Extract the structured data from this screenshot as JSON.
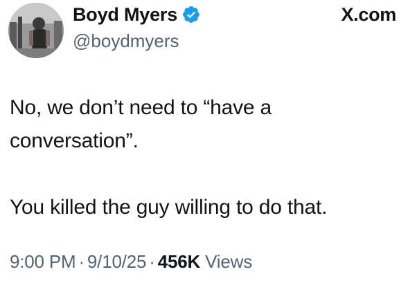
{
  "author": {
    "display_name": "Boyd Myers",
    "handle": "@boydmyers",
    "verified": true
  },
  "source": "X.com",
  "tweet": {
    "lines": [
      "No, we don’t need to “have a",
      "conversation”.",
      "You killed the guy willing to do that."
    ],
    "time": "9:00 PM",
    "date": "9/10/25",
    "separator": "·",
    "views_count": "456K",
    "views_label": "Views"
  },
  "colors": {
    "text": "#0f1419",
    "secondary": "#536471",
    "verified_badge": "#1d9bf0"
  },
  "icons": {
    "verified": "verified-badge-icon",
    "avatar": "avatar-photo"
  }
}
